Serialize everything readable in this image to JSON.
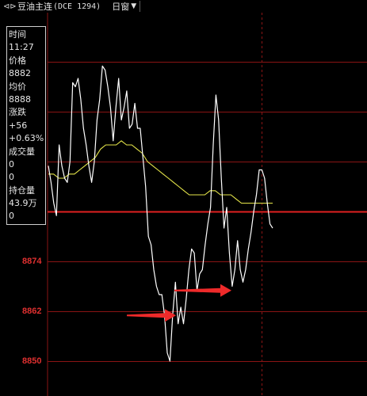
{
  "header": {
    "title": "豆油主连",
    "code": "(DCE 1294)",
    "window_mode": "日窗"
  },
  "info_panel": {
    "time_label": "时间",
    "time_value": "11:27",
    "price_label": "价格",
    "price_value": "8882",
    "avg_label": "均价",
    "avg_value": "8888",
    "change_label": "涨跌",
    "change_value": "+56",
    "change_pct": "+0.63%",
    "volume_label": "成交量",
    "volume_value_1": "0",
    "volume_value_2": "0",
    "oi_label": "持仓量",
    "oi_value": "43.9万",
    "oi_change": "0"
  },
  "y_axis_labels": [
    "8874",
    "8862",
    "8850"
  ],
  "colors": {
    "background": "#000000",
    "grid": "#8a1414",
    "baseline": "#e02020",
    "price_line": "#ffffff",
    "avg_line": "#e6e64a",
    "axis_label": "#e03030",
    "annotation_arrow": "#ee2a2a"
  },
  "chart_data": {
    "type": "line",
    "title": "",
    "xlabel": "",
    "ylabel": "",
    "ylim": [
      8846,
      8926
    ],
    "y_ticks": [
      8850,
      8862,
      8874,
      8886,
      8898,
      8910,
      8922
    ],
    "y_tick_labels_shown": [
      8874,
      8862,
      8850
    ],
    "prev_settle": 8886,
    "series": [
      {
        "role": "price",
        "values": [
          8897,
          8893,
          8888,
          8885,
          8902,
          8897,
          8894,
          8893,
          8898,
          8917,
          8916,
          8918,
          8913,
          8906,
          8902,
          8897,
          8893,
          8898,
          8908,
          8913,
          8921,
          8920,
          8916,
          8911,
          8903,
          8911,
          8918,
          8908,
          8911,
          8915,
          8906,
          8907,
          8912,
          8906,
          8906,
          8899,
          8892,
          8880,
          8878,
          8872,
          8868,
          8866,
          8866,
          8861,
          8852,
          8850,
          8861,
          8869,
          8859,
          8863,
          8859,
          8865,
          8872,
          8877,
          8876,
          8867,
          8871,
          8872,
          8878,
          8883,
          8887,
          8902,
          8914,
          8908,
          8894,
          8882,
          8887,
          8876,
          8868,
          8872,
          8879,
          8872,
          8869,
          8872,
          8877,
          8881,
          8886,
          8890,
          8896,
          8896,
          8894,
          8888,
          8883,
          8882
        ]
      },
      {
        "role": "average",
        "values": [
          8895,
          8895,
          8894,
          8894,
          8895,
          8895,
          8896,
          8897,
          8898,
          8899,
          8901,
          8902,
          8902,
          8902,
          8903,
          8902,
          8902,
          8901,
          8900,
          8898,
          8897,
          8896,
          8895,
          8894,
          8893,
          8892,
          8891,
          8890,
          8890,
          8890,
          8890,
          8891,
          8891,
          8890,
          8890,
          8890,
          8889,
          8888,
          8888,
          8888,
          8888,
          8888,
          8888,
          8888
        ]
      }
    ],
    "annotations": [
      {
        "type": "arrow",
        "at_price": 8861,
        "direction": "right"
      },
      {
        "type": "arrow",
        "at_price": 8867,
        "direction": "right"
      }
    ]
  }
}
